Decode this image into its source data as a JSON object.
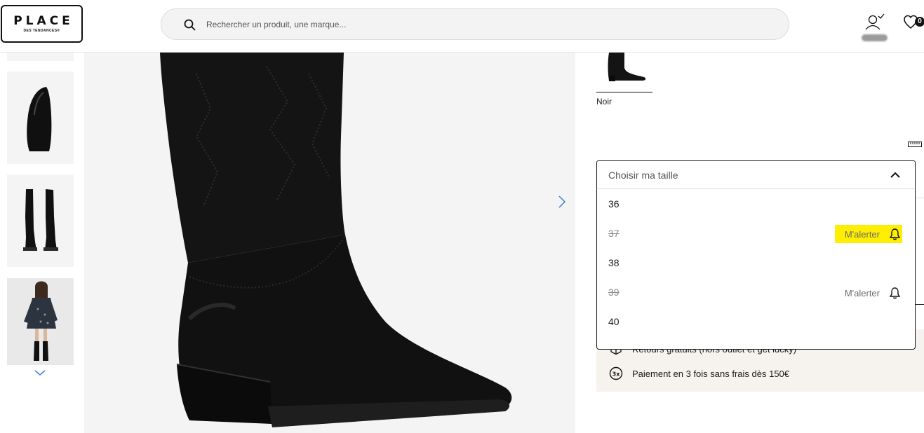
{
  "header": {
    "logo_main": "PLACE",
    "logo_sub": "DES TENDANCES®",
    "search_placeholder": "Rechercher un produit, une marque...",
    "wishlist_count": "0"
  },
  "gallery": {
    "thumbnails": [
      "boot-sole-view",
      "boots-pair-view",
      "model-wearing-view"
    ]
  },
  "product": {
    "color_label": "Noir",
    "size_select": {
      "placeholder": "Choisir ma taille",
      "options": [
        {
          "label": "36",
          "available": true
        },
        {
          "label": "37",
          "available": false,
          "alert": "M'alerter",
          "highlighted": true
        },
        {
          "label": "38",
          "available": true
        },
        {
          "label": "39",
          "available": false,
          "alert": "M'alerter",
          "highlighted": false
        },
        {
          "label": "40",
          "available": true
        }
      ]
    },
    "services": [
      {
        "icon": "box-icon",
        "text": "Retours gratuits (hors outlet et get lucky)"
      },
      {
        "icon": "three-times-icon",
        "text": "Paiement en 3 fois sans frais dès 150€"
      }
    ]
  },
  "colors": {
    "highlight": "#ffee00",
    "text": "#1a1a1a",
    "muted": "#8a8a8a",
    "info_bg": "#f6f3ee"
  }
}
